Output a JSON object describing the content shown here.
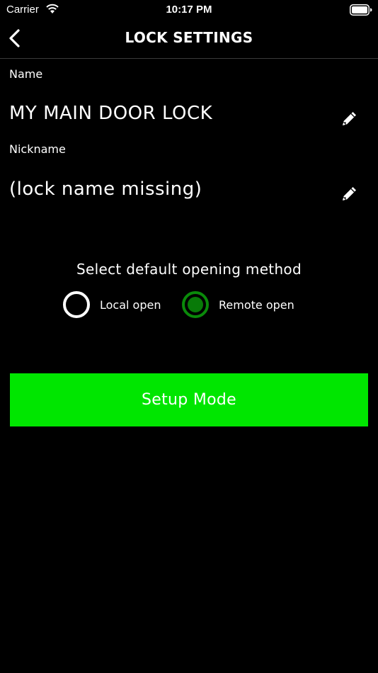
{
  "status_bar": {
    "carrier": "Carrier",
    "time": "10:17 PM",
    "wifi_icon": "wifi-icon",
    "battery_icon": "battery-icon"
  },
  "nav": {
    "title": "LOCK SETTINGS",
    "back_icon": "chevron-left-icon"
  },
  "name_field": {
    "label": "Name",
    "value": "MY MAIN DOOR LOCK",
    "edit_icon": "pencil-icon"
  },
  "nickname_field": {
    "label": "Nickname",
    "value": "(lock name missing)",
    "edit_icon": "pencil-icon"
  },
  "opening_method": {
    "title": "Select default opening method",
    "options": [
      {
        "label": "Local open",
        "selected": false
      },
      {
        "label": "Remote open",
        "selected": true
      }
    ]
  },
  "setup_button": {
    "label": "Setup Mode",
    "color": "#00e600"
  },
  "colors": {
    "background": "#000000",
    "accent_green": "#00e600",
    "radio_selected": "#087a08"
  }
}
